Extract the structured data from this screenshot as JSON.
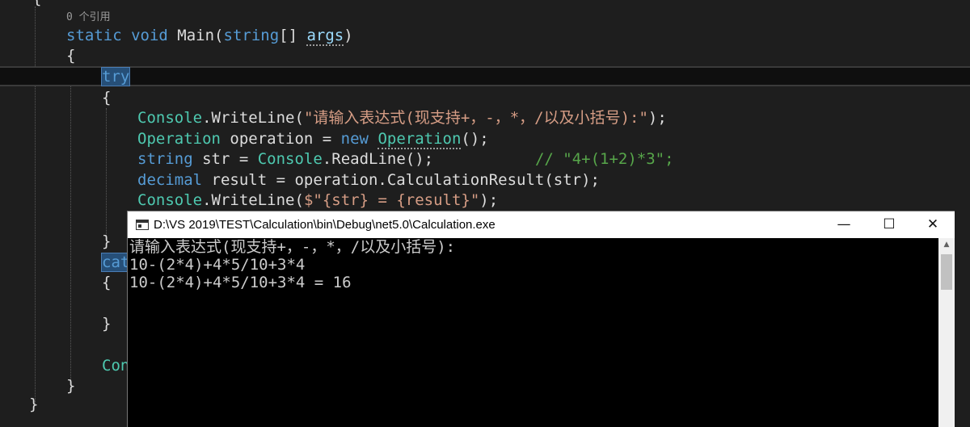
{
  "editor": {
    "top_brace": "{",
    "codelens": "0 个引用",
    "sig": {
      "kw_static": "static",
      "kw_void": "void",
      "name": " Main(",
      "type_string": "string",
      "brackets": "[] ",
      "param": "args",
      "close": ")"
    },
    "open_brace": "{",
    "try_kw": "try",
    "try_open": "{",
    "line1": {
      "cls": "Console",
      "dot": ".",
      "meth": "WriteLine",
      "paren": "(",
      "text": "\"请输入表达式(现支持+，-，*，/以及小括号):\"",
      "end": ");"
    },
    "line2": {
      "type": "Operation",
      "var": " operation = ",
      "kw_new": "new",
      "space": " ",
      "type2": "Operation",
      "end": "();"
    },
    "line3": {
      "kw": "string",
      "var": " str = ",
      "cls": "Console",
      "dot": ".",
      "meth": "ReadLine",
      "end": "();",
      "gap": "           ",
      "comment": "// \"4+(1+2)*3\";"
    },
    "line4": {
      "kw": "decimal",
      "var": " result = operation.",
      "meth": "CalculationResult",
      "end": "(str);"
    },
    "line5": {
      "cls": "Console",
      "dot": ".",
      "meth": "WriteLine",
      "paren": "(",
      "text": "$\"{str} = {result}\"",
      "end": ");"
    },
    "try_close": "}",
    "catch_partial": "cat",
    "catch_open": "{",
    "catch_close": "}",
    "con_partial": "Con",
    "method_close": "}",
    "class_close": "}"
  },
  "console": {
    "title": "D:\\VS 2019\\TEST\\Calculation\\bin\\Debug\\net5.0\\Calculation.exe",
    "minimize": "—",
    "maximize": "☐",
    "close": "✕",
    "lines": [
      "请输入表达式(现支持+，-，*，/以及小括号):",
      "10-(2*4)+4*5/10+3*4",
      "10-(2*4)+4*5/10+3*4 = 16"
    ],
    "scroll_up": "▲"
  },
  "colors": {
    "editor_bg": "#1e1e1e",
    "keyword": "#569cd6",
    "type": "#4ec9b0",
    "string": "#d69d85",
    "comment": "#57a64a",
    "console_bg": "#000000",
    "console_text": "#cccccc"
  }
}
